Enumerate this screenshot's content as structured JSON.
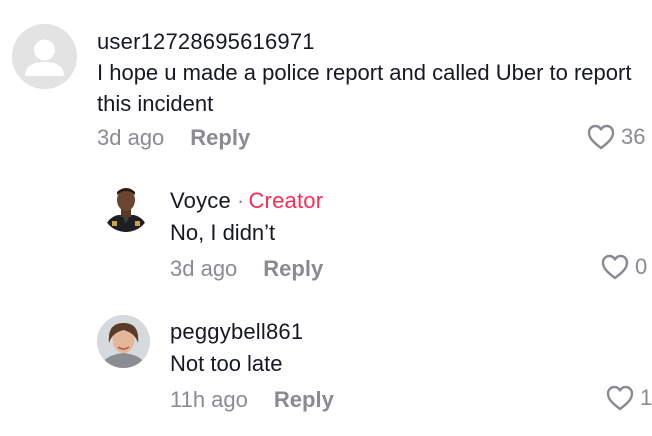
{
  "comments": [
    {
      "username": "user12728695616971",
      "text": "I hope u made a police report and called Uber to report this incident",
      "time": "3d ago",
      "reply_label": "Reply",
      "likes": "36",
      "avatar": "default-avatar"
    },
    {
      "username": "Voyce",
      "badge_sep": "·",
      "badge": "Creator",
      "text": "No, I didn’t",
      "time": "3d ago",
      "reply_label": "Reply",
      "likes": "0",
      "avatar": "uniformed-man-avatar"
    },
    {
      "username": "peggybell861",
      "text": "Not too late",
      "time": "11h ago",
      "reply_label": "Reply",
      "likes": "1",
      "avatar": "woman-avatar"
    }
  ],
  "colors": {
    "creator": "#fe2c55",
    "meta": "#8a8b91",
    "text": "#161823"
  },
  "icons": {
    "like": "heart-outline-icon"
  }
}
